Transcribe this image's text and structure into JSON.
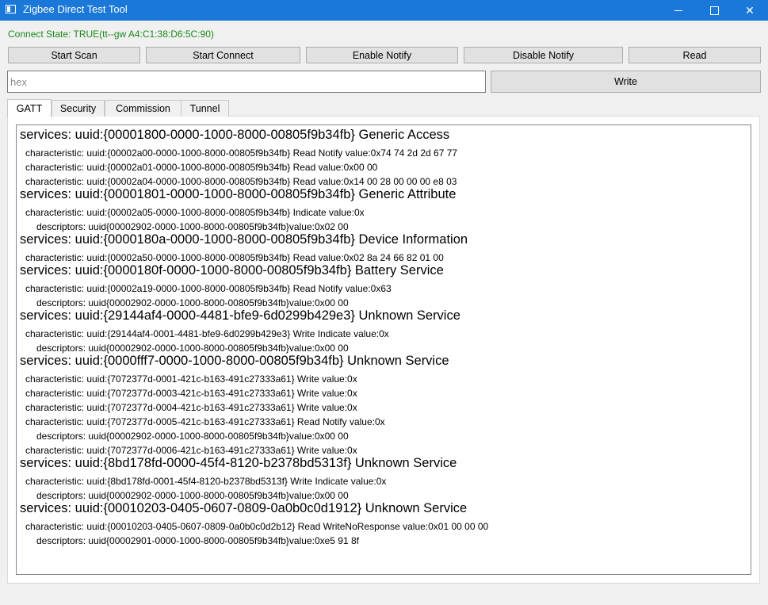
{
  "window": {
    "title": "Zigbee Direct Test Tool",
    "icon": "app-window-icon",
    "controls": [
      "minimize-icon",
      "maximize-icon",
      "close-icon"
    ],
    "close_glyph": "✕"
  },
  "status": {
    "text": "Connect State: TRUE(tt--gw  A4:C1:38:D6:5C:90)",
    "color": "#1a8a1a"
  },
  "toolbar": {
    "start_scan": "Start Scan",
    "start_connect": "Start Connect",
    "enable_notify": "Enable Notify",
    "disable_notify": "Disable Notify",
    "read": "Read",
    "write": "Write"
  },
  "input": {
    "placeholder": "hex",
    "value": ""
  },
  "tabs": [
    {
      "label": "GATT",
      "active": true
    },
    {
      "label": "Security",
      "active": false
    },
    {
      "label": "Commission",
      "active": false
    },
    {
      "label": "Tunnel",
      "active": false
    }
  ],
  "gatt_lines": [
    {
      "type": "service",
      "text": "services: uuid:{00001800-0000-1000-8000-00805f9b34fb}  Generic Access"
    },
    {
      "type": "characteristic",
      "text": "characteristic: uuid:{00002a00-0000-1000-8000-00805f9b34fb} Read Notify  value:0x74 74 2d 2d 67 77"
    },
    {
      "type": "characteristic",
      "text": "characteristic: uuid:{00002a01-0000-1000-8000-00805f9b34fb} Read  value:0x00 00"
    },
    {
      "type": "characteristic",
      "text": "characteristic: uuid:{00002a04-0000-1000-8000-00805f9b34fb} Read  value:0x14 00 28 00 00 00 e8 03"
    },
    {
      "type": "service",
      "text": "services: uuid:{00001801-0000-1000-8000-00805f9b34fb}  Generic Attribute"
    },
    {
      "type": "characteristic",
      "text": "characteristic: uuid:{00002a05-0000-1000-8000-00805f9b34fb} Indicate  value:0x"
    },
    {
      "type": "descriptor",
      "text": "descriptors: uuid{00002902-0000-1000-8000-00805f9b34fb}value:0x02 00"
    },
    {
      "type": "service",
      "text": "services: uuid:{0000180a-0000-1000-8000-00805f9b34fb}  Device Information"
    },
    {
      "type": "characteristic",
      "text": "characteristic: uuid:{00002a50-0000-1000-8000-00805f9b34fb} Read  value:0x02 8a 24 66 82 01 00"
    },
    {
      "type": "service",
      "text": "services: uuid:{0000180f-0000-1000-8000-00805f9b34fb}  Battery Service"
    },
    {
      "type": "characteristic",
      "text": "characteristic: uuid:{00002a19-0000-1000-8000-00805f9b34fb} Read Notify  value:0x63"
    },
    {
      "type": "descriptor",
      "text": "descriptors: uuid{00002902-0000-1000-8000-00805f9b34fb}value:0x00 00"
    },
    {
      "type": "service",
      "text": "services: uuid:{29144af4-0000-4481-bfe9-6d0299b429e3}  Unknown Service"
    },
    {
      "type": "characteristic",
      "text": "characteristic: uuid:{29144af4-0001-4481-bfe9-6d0299b429e3} Write Indicate  value:0x"
    },
    {
      "type": "descriptor",
      "text": "descriptors: uuid{00002902-0000-1000-8000-00805f9b34fb}value:0x00 00"
    },
    {
      "type": "service",
      "text": "services: uuid:{0000fff7-0000-1000-8000-00805f9b34fb}  Unknown Service"
    },
    {
      "type": "characteristic",
      "text": "characteristic: uuid:{7072377d-0001-421c-b163-491c27333a61} Write  value:0x"
    },
    {
      "type": "characteristic",
      "text": "characteristic: uuid:{7072377d-0003-421c-b163-491c27333a61} Write  value:0x"
    },
    {
      "type": "characteristic",
      "text": "characteristic: uuid:{7072377d-0004-421c-b163-491c27333a61} Write  value:0x"
    },
    {
      "type": "characteristic",
      "text": "characteristic: uuid:{7072377d-0005-421c-b163-491c27333a61} Read Notify  value:0x"
    },
    {
      "type": "descriptor",
      "text": "descriptors: uuid{00002902-0000-1000-8000-00805f9b34fb}value:0x00 00"
    },
    {
      "type": "characteristic",
      "text": "characteristic: uuid:{7072377d-0006-421c-b163-491c27333a61} Write  value:0x"
    },
    {
      "type": "service",
      "text": "services: uuid:{8bd178fd-0000-45f4-8120-b2378bd5313f}  Unknown Service"
    },
    {
      "type": "characteristic",
      "text": "characteristic: uuid:{8bd178fd-0001-45f4-8120-b2378bd5313f} Write Indicate  value:0x"
    },
    {
      "type": "descriptor",
      "text": "descriptors: uuid{00002902-0000-1000-8000-00805f9b34fb}value:0x00 00"
    },
    {
      "type": "service",
      "text": "services: uuid:{00010203-0405-0607-0809-0a0b0c0d1912}  Unknown Service"
    },
    {
      "type": "characteristic",
      "text": "characteristic: uuid:{00010203-0405-0607-0809-0a0b0c0d2b12} Read WriteNoResponse  value:0x01 00 00 00"
    },
    {
      "type": "descriptor",
      "text": "descriptors: uuid{00002901-0000-1000-8000-00805f9b34fb}value:0xe5 91 8f"
    }
  ]
}
